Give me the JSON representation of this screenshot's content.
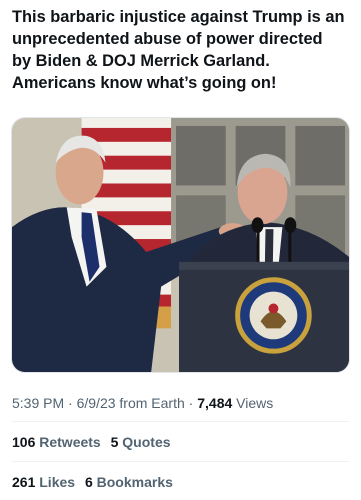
{
  "tweet": {
    "text": "This barbaric injustice against Trump is an\nunprecedented abuse of power directed\nby Biden & DOJ Merrick Garland.\nAmericans know what’s going on!",
    "image_alt": "Biden with hand on Merrick Garland's shoulder at a podium with the presidential seal",
    "seal_text": "PRESIDENT OF THE UNITED STATES"
  },
  "meta": {
    "time": "5:39 PM",
    "sep1": " · ",
    "date": "6/9/23",
    "source": " from Earth",
    "sep2": " · ",
    "views_count": "7,484",
    "views_label": " Views"
  },
  "stats": {
    "retweets_count": "106",
    "retweets_label": " Retweets",
    "quotes_count": "5",
    "quotes_label": " Quotes",
    "likes_count": "261",
    "likes_label": " Likes",
    "bookmarks_count": "6",
    "bookmarks_label": " Bookmarks"
  },
  "colors": {
    "text": "#0f1419",
    "secondary": "#536471",
    "divider": "#eff3f4"
  }
}
